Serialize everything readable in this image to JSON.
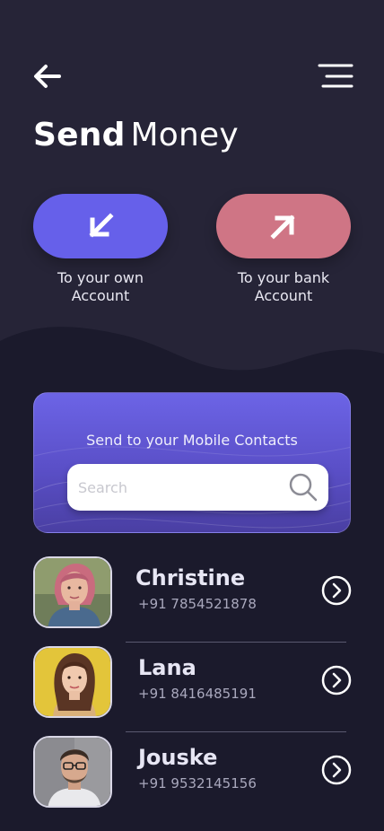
{
  "header": {
    "title_bold": "Send",
    "title_light": "Money",
    "back_icon": "arrow-left-icon",
    "menu_icon": "hamburger-menu-icon"
  },
  "actions": {
    "own": {
      "label_line1": "To your own",
      "label_line2": "Account",
      "icon": "arrow-down-left-icon",
      "color": "#6660ea"
    },
    "bank": {
      "label_line1": "To your bank",
      "label_line2": "Account",
      "icon": "arrow-up-right-icon",
      "color": "#cf7585"
    }
  },
  "contacts_card": {
    "title": "Send to your Mobile Contacts",
    "search_placeholder": "Search",
    "search_value": ""
  },
  "contacts": [
    {
      "name": "Christine",
      "phone": "+91 7854521878"
    },
    {
      "name": "Lana",
      "phone": "+91 8416485191"
    },
    {
      "name": "Jouske",
      "phone": "+91 9532145156"
    }
  ],
  "colors": {
    "background_top": "#262437",
    "background_bottom": "#1b1a2c",
    "accent_purple": "#6660ea",
    "accent_pink": "#cf7585"
  }
}
